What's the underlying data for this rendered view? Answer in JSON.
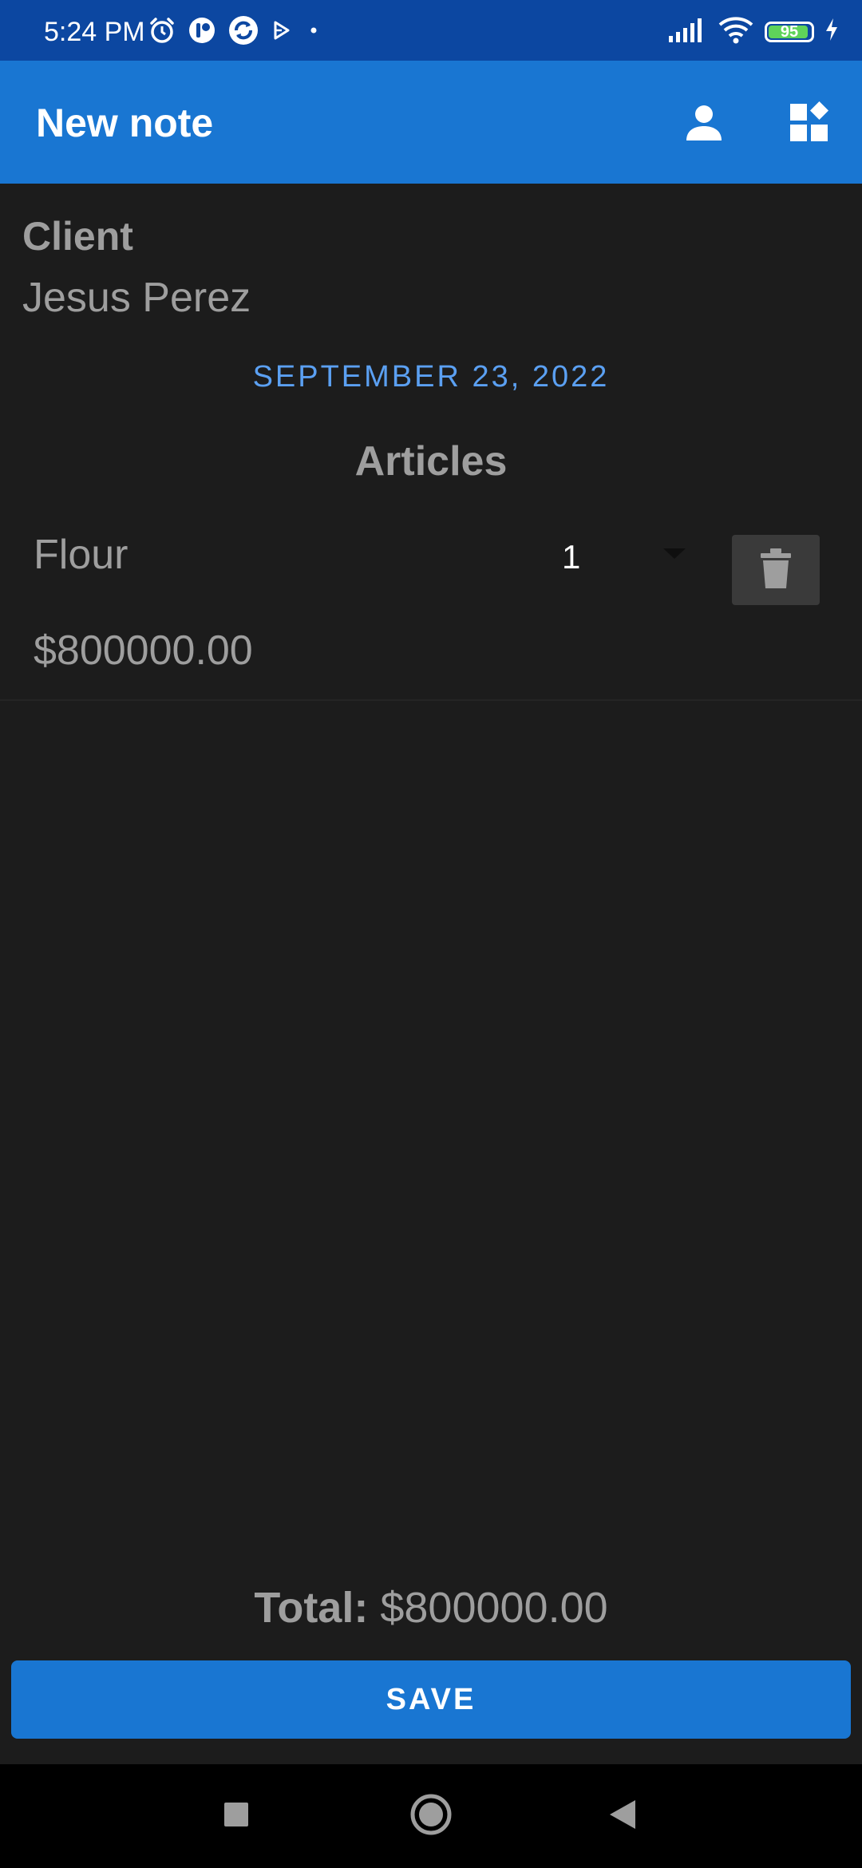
{
  "status_bar": {
    "time": "5:24 PM",
    "battery_level": 95,
    "battery_text": "95",
    "icons": [
      "alarm-icon",
      "app-notification-icon",
      "sync-app-icon",
      "play-store-icon",
      "dot-icon",
      "signal-icon",
      "wifi-icon",
      "battery-icon",
      "charging-icon"
    ]
  },
  "app_bar": {
    "title": "New note",
    "actions": [
      "person-icon",
      "widgets-icon"
    ]
  },
  "client": {
    "label": "Client",
    "name": "Jesus Perez"
  },
  "date": "SEPTEMBER 23, 2022",
  "articles": {
    "title": "Articles",
    "items": [
      {
        "name": "Flour",
        "quantity": "1",
        "price": "$800000.00"
      }
    ]
  },
  "total": {
    "label": "Total:",
    "value": "$800000.00"
  },
  "save_label": "SAVE",
  "colors": {
    "status_bar": "#0c47a1",
    "app_bar": "#1976d2",
    "background": "#1c1c1c",
    "date_accent": "#5ba0f2",
    "battery": "#5fd35a"
  }
}
